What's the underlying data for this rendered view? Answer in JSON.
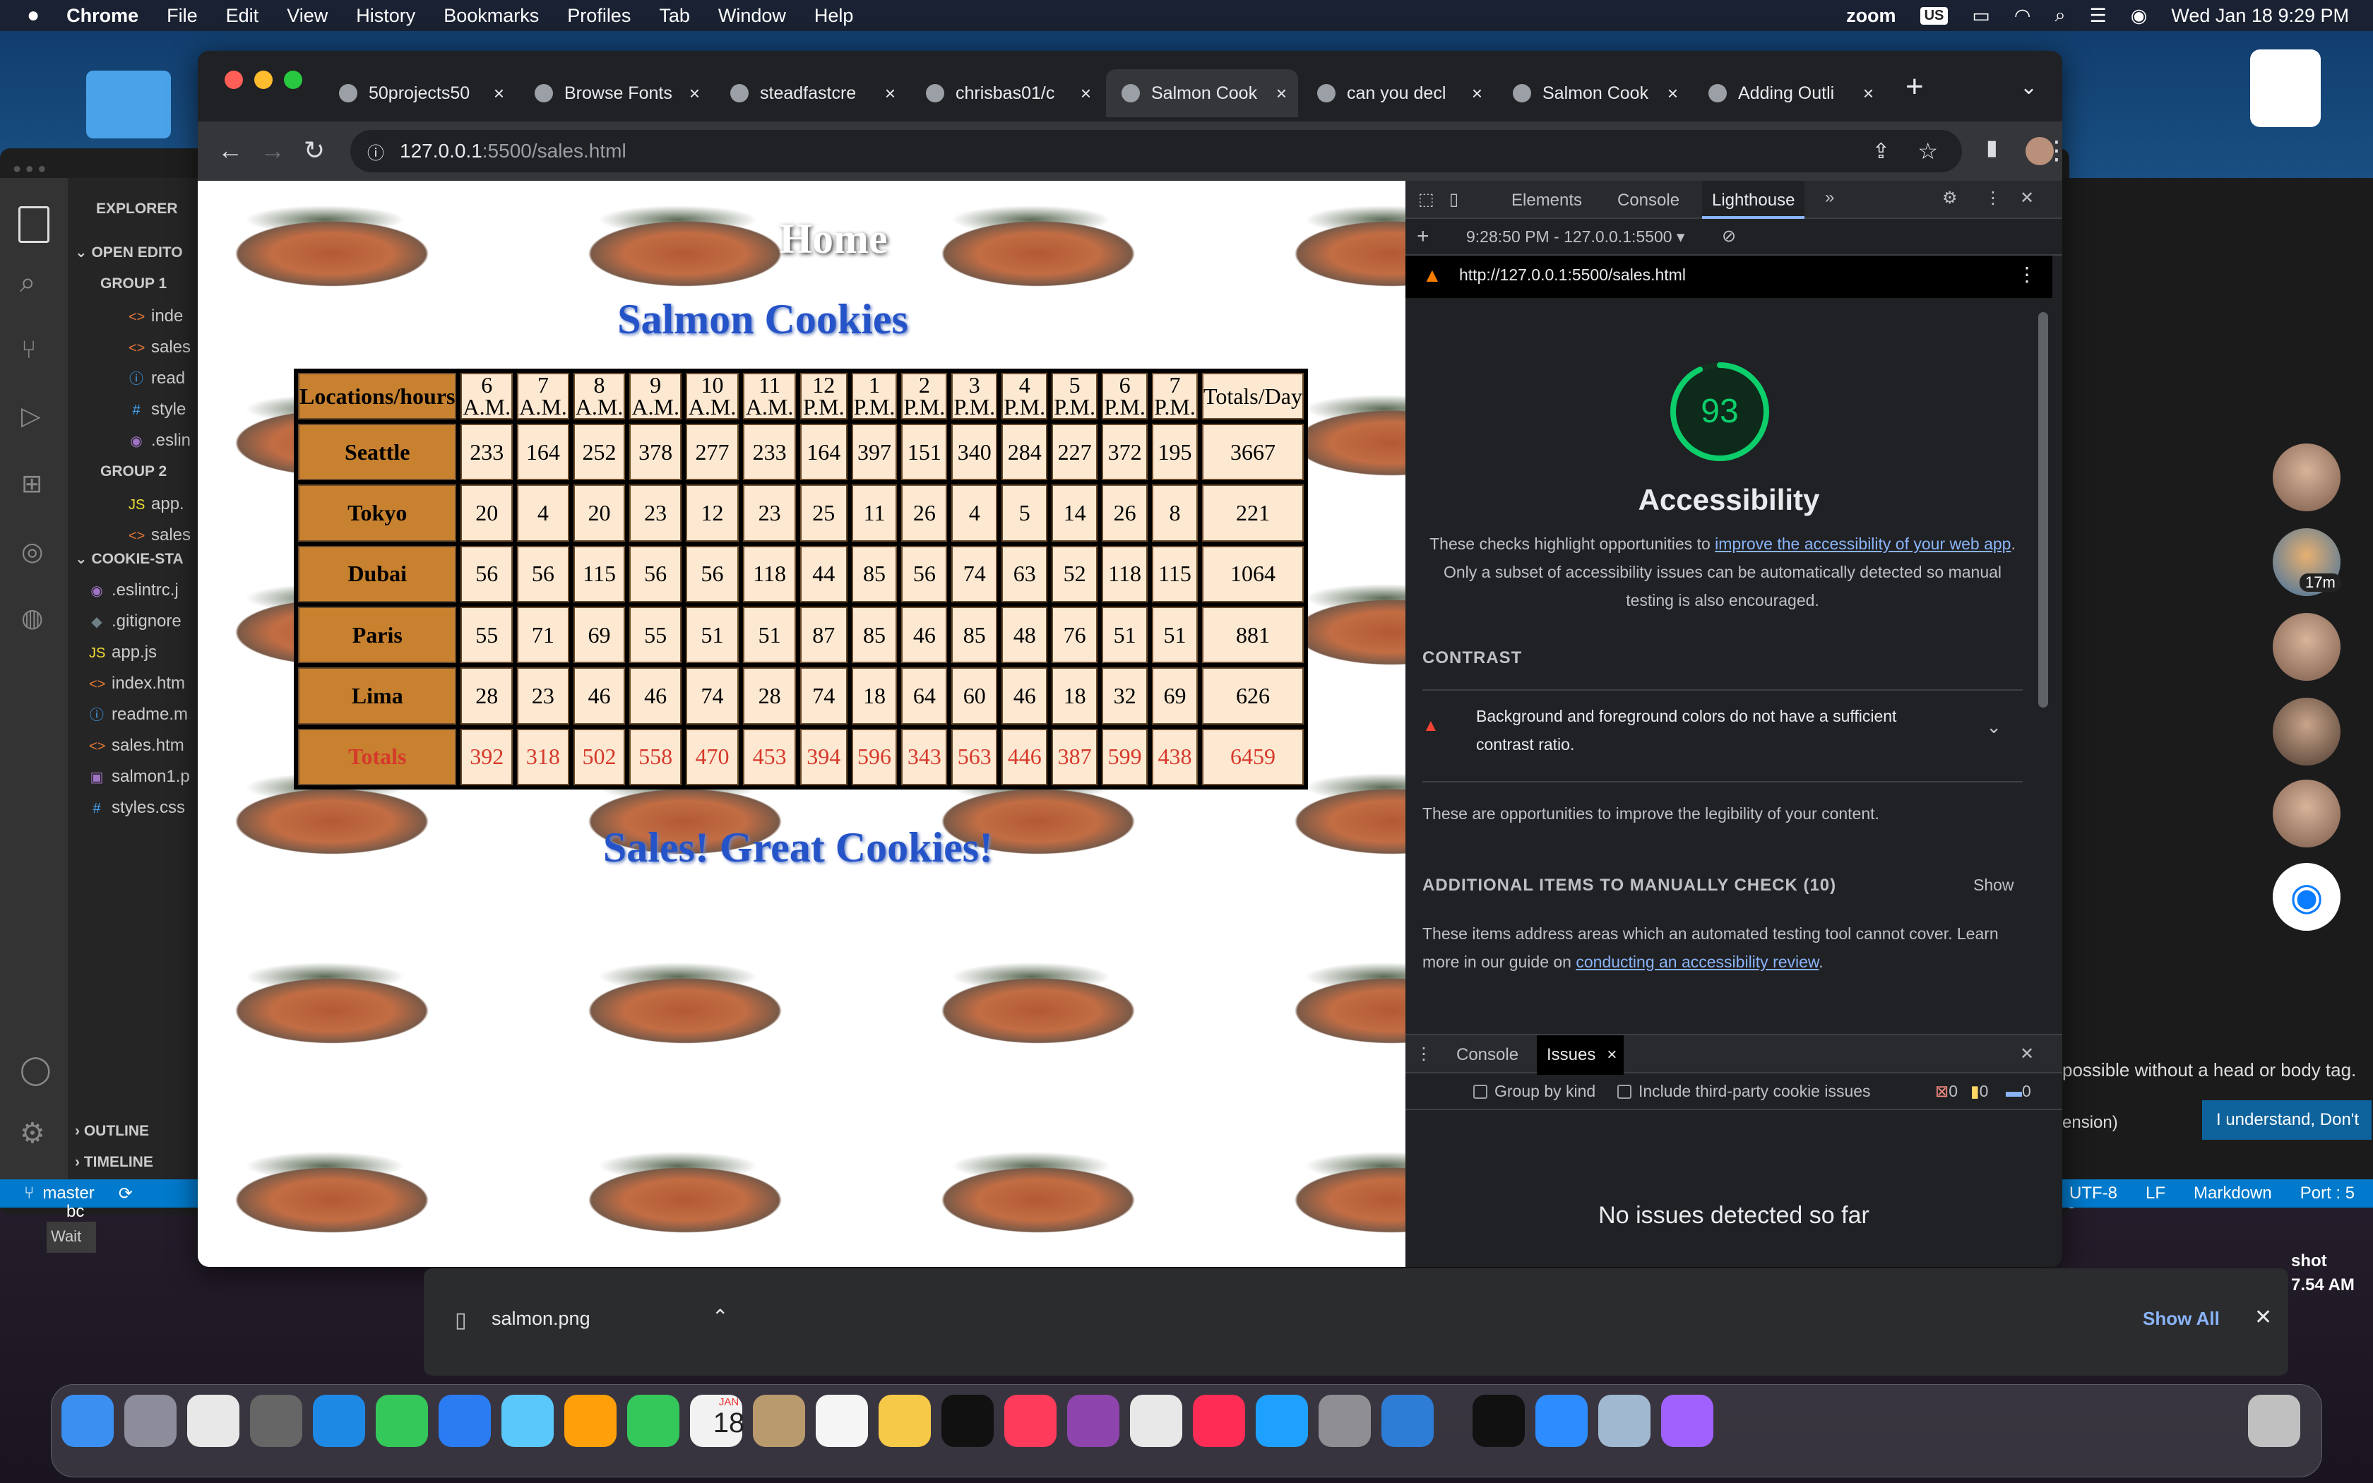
{
  "menubar": {
    "app": "Chrome",
    "items": [
      "File",
      "Edit",
      "View",
      "History",
      "Bookmarks",
      "Profiles",
      "Tab",
      "Window",
      "Help"
    ],
    "zoom": "zoom",
    "input": "US",
    "datetime": "Wed Jan 18  9:29 PM"
  },
  "vscode": {
    "explorer": "EXPLORER",
    "open_editors": "OPEN EDITO",
    "group1": "GROUP 1",
    "group1_files": [
      {
        "icon": "<>",
        "name": "inde",
        "color": "#e37933"
      },
      {
        "icon": "<>",
        "name": "sales",
        "color": "#e37933"
      },
      {
        "icon": "ⓘ",
        "name": "read",
        "color": "#42a5f5"
      },
      {
        "icon": "#",
        "name": "style",
        "color": "#42a5f5"
      },
      {
        "icon": "◉",
        "name": ".eslin",
        "color": "#a074c4"
      }
    ],
    "group2": "GROUP 2",
    "group2_files": [
      {
        "icon": "JS",
        "name": "app.",
        "color": "#f1dd35"
      },
      {
        "icon": "<>",
        "name": "sales",
        "color": "#e37933"
      }
    ],
    "project": "COOKIE-STA",
    "project_files": [
      {
        "icon": "◉",
        "name": ".eslintrc.j",
        "color": "#a074c4"
      },
      {
        "icon": "◆",
        "name": ".gitignore",
        "color": "#6d8086"
      },
      {
        "icon": "JS",
        "name": "app.js",
        "color": "#f1dd35"
      },
      {
        "icon": "<>",
        "name": "index.htm",
        "color": "#e37933"
      },
      {
        "icon": "ⓘ",
        "name": "readme.m",
        "color": "#42a5f5"
      },
      {
        "icon": "<>",
        "name": "sales.htm",
        "color": "#e37933"
      },
      {
        "icon": "▣",
        "name": "salmon1.p",
        "color": "#a074c4"
      },
      {
        "icon": "#",
        "name": "styles.css",
        "color": "#42a5f5"
      }
    ],
    "outline": "OUTLINE",
    "timeline": "TIMELINE",
    "branch": "master",
    "status_right": [
      "UTF-8",
      "LF",
      "Markdown",
      "Port : 5"
    ],
    "notice": "possible without a head or body tag.",
    "notice2": "ension)",
    "notice_button": "I understand, Don't",
    "wait": "Wait",
    "bc": "bc"
  },
  "chrome": {
    "tabs": [
      {
        "title": "50projects50",
        "active": false
      },
      {
        "title": "Browse Fonts",
        "active": false
      },
      {
        "title": "steadfastcre",
        "active": false
      },
      {
        "title": "chrisbas01/c",
        "active": false
      },
      {
        "title": "Salmon Cook",
        "active": true
      },
      {
        "title": "can you decl",
        "active": false
      },
      {
        "title": "Salmon Cook",
        "active": false
      },
      {
        "title": "Adding Outli",
        "active": false
      }
    ],
    "url_host": "127.0.0.1",
    "url_rest": ":5500/sales.html"
  },
  "page": {
    "home": "Home",
    "title": "Salmon Cookies",
    "footer": "Sales! Great Cookies!",
    "headers": [
      "Locations/hours",
      "6 A.M.",
      "7 A.M.",
      "8 A.M.",
      "9 A.M.",
      "10 A.M.",
      "11 A.M.",
      "12 P.M.",
      "1 P.M.",
      "2 P.M.",
      "3 P.M.",
      "4 P.M.",
      "5 P.M.",
      "6 P.M.",
      "7 P.M.",
      "Totals/Day"
    ],
    "rows": [
      {
        "loc": "Seattle",
        "values": [
          "233",
          "164",
          "252",
          "378",
          "277",
          "233",
          "164",
          "397",
          "151",
          "340",
          "284",
          "227",
          "372",
          "195"
        ],
        "total": "3667"
      },
      {
        "loc": "Tokyo",
        "values": [
          "20",
          "4",
          "20",
          "23",
          "12",
          "23",
          "25",
          "11",
          "26",
          "4",
          "5",
          "14",
          "26",
          "8"
        ],
        "total": "221"
      },
      {
        "loc": "Dubai",
        "values": [
          "56",
          "56",
          "115",
          "56",
          "56",
          "118",
          "44",
          "85",
          "56",
          "74",
          "63",
          "52",
          "118",
          "115"
        ],
        "total": "1064"
      },
      {
        "loc": "Paris",
        "values": [
          "55",
          "71",
          "69",
          "55",
          "51",
          "51",
          "87",
          "85",
          "46",
          "85",
          "48",
          "76",
          "51",
          "51"
        ],
        "total": "881"
      },
      {
        "loc": "Lima",
        "values": [
          "28",
          "23",
          "46",
          "46",
          "74",
          "28",
          "74",
          "18",
          "64",
          "60",
          "46",
          "18",
          "32",
          "69"
        ],
        "total": "626"
      }
    ],
    "totals": {
      "loc": "Totals",
      "values": [
        "392",
        "318",
        "502",
        "558",
        "470",
        "453",
        "394",
        "596",
        "343",
        "563",
        "446",
        "387",
        "599",
        "438"
      ],
      "total": "6459"
    }
  },
  "devtools": {
    "tabs": [
      "Elements",
      "Console",
      "Lighthouse"
    ],
    "report_time": "9:28:50 PM - 127.0.0.1:5500",
    "report_url": "http://127.0.0.1:5500/sales.html",
    "score": 93,
    "category": "Accessibility",
    "desc_pre": "These checks highlight opportunities to ",
    "desc_link": "improve the accessibility of your web app",
    "desc_post": ". Only a subset of accessibility issues can be automatically detected so manual testing is also encouraged.",
    "contrast": "CONTRAST",
    "audit": "Background and foreground colors do not have a sufficient contrast ratio.",
    "legibility": "These are opportunities to improve the legibility of your content.",
    "manual": "ADDITIONAL ITEMS TO MANUALLY CHECK (10)",
    "show": "Show",
    "manual_desc": "These items address areas which an automated testing tool cannot cover. Learn more in our guide on ",
    "manual_link": "conducting an accessibility review",
    "drawer_tabs": [
      "Console",
      "Issues"
    ],
    "group_by_kind": "Group by kind",
    "third_party": "Include third-party cookie issues",
    "counts": [
      "0",
      "0",
      "0"
    ],
    "no_issues": "No issues detected so far",
    "score_color": "#0cce6b"
  },
  "download": {
    "file": "salmon.png",
    "show_all": "Show All"
  },
  "screenshot": {
    "label": "shot",
    "time": "7.54 AM"
  },
  "avatars": {
    "badge": "17m"
  },
  "dock": {
    "calendar_month": "JAN",
    "calendar_day": "18"
  }
}
